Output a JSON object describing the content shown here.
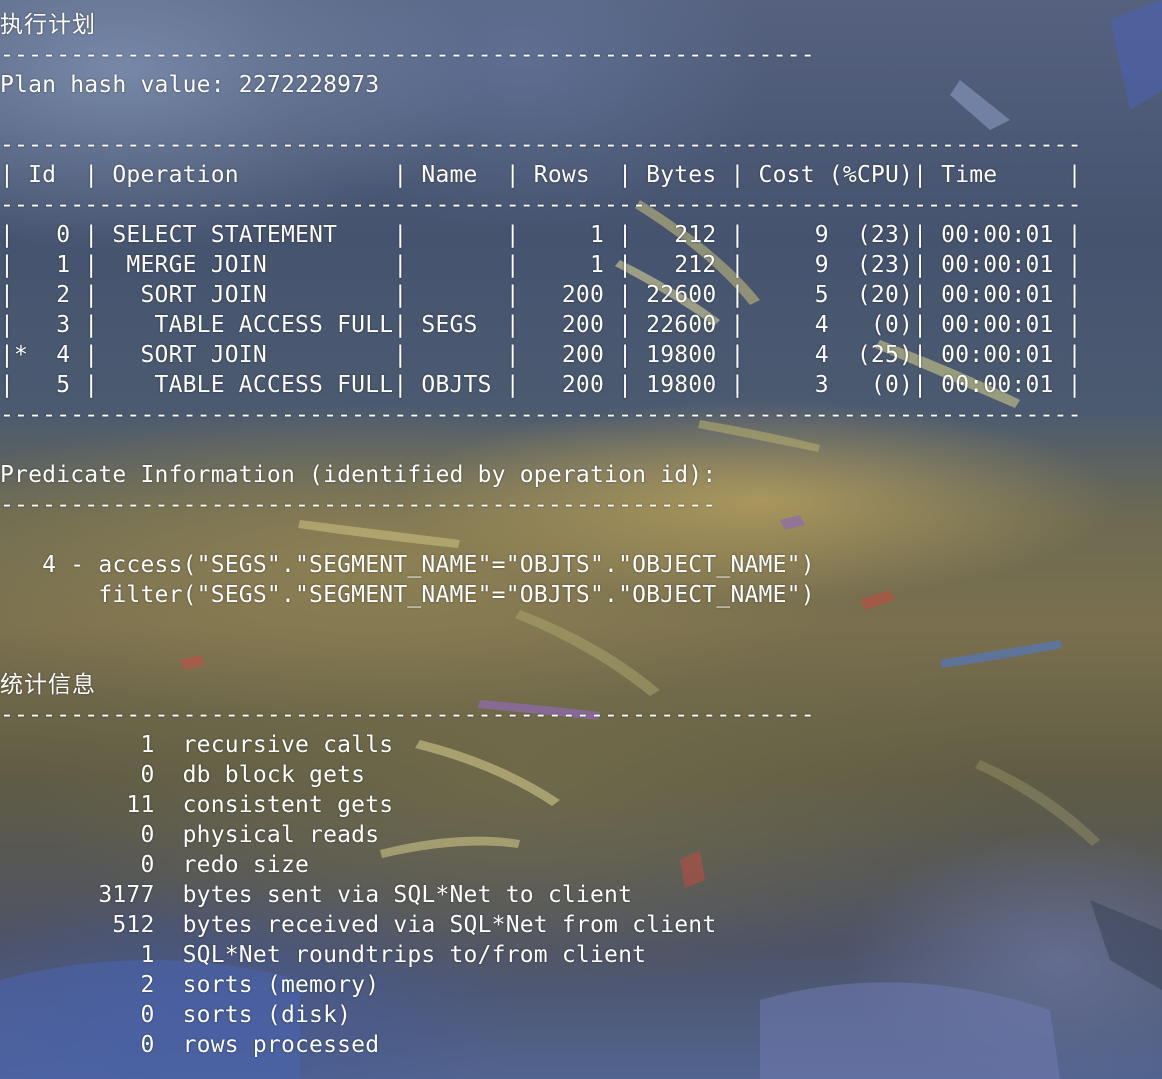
{
  "terminal": {
    "lines": [
      "执行计划",
      "----------------------------------------------------------",
      "Plan hash value: 2272228973",
      "",
      "-----------------------------------------------------------------------------",
      "| Id  | Operation           | Name  | Rows  | Bytes | Cost (%CPU)| Time     |",
      "-----------------------------------------------------------------------------",
      "|   0 | SELECT STATEMENT    |       |     1 |   212 |     9  (23)| 00:00:01 |",
      "|   1 |  MERGE JOIN         |       |     1 |   212 |     9  (23)| 00:00:01 |",
      "|   2 |   SORT JOIN         |       |   200 | 22600 |     5  (20)| 00:00:01 |",
      "|   3 |    TABLE ACCESS FULL| SEGS  |   200 | 22600 |     4   (0)| 00:00:01 |",
      "|*  4 |   SORT JOIN         |       |   200 | 19800 |     4  (25)| 00:00:01 |",
      "|   5 |    TABLE ACCESS FULL| OBJTS |   200 | 19800 |     3   (0)| 00:00:01 |",
      "-----------------------------------------------------------------------------",
      "",
      "Predicate Information (identified by operation id):",
      "---------------------------------------------------",
      "",
      "   4 - access(\"SEGS\".\"SEGMENT_NAME\"=\"OBJTS\".\"OBJECT_NAME\")",
      "       filter(\"SEGS\".\"SEGMENT_NAME\"=\"OBJTS\".\"OBJECT_NAME\")",
      "",
      "",
      "统计信息",
      "----------------------------------------------------------",
      "          1  recursive calls",
      "          0  db block gets",
      "         11  consistent gets",
      "          0  physical reads",
      "          0  redo size",
      "       3177  bytes sent via SQL*Net to client",
      "        512  bytes received via SQL*Net from client",
      "          1  SQL*Net roundtrips to/from client",
      "          2  sorts (memory)",
      "          0  sorts (disk)",
      "          0  rows processed"
    ]
  }
}
